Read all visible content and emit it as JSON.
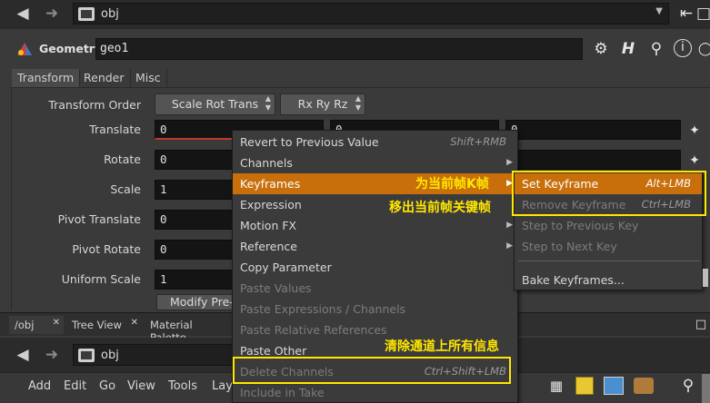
{
  "top_nav": {
    "path": "obj"
  },
  "geometry_header": {
    "type_label": "Geometry",
    "node_name": "geo1"
  },
  "param_tabs": [
    "Transform",
    "Render",
    "Misc"
  ],
  "params": {
    "transform_order": {
      "label": "Transform Order",
      "value": "Scale Rot Trans",
      "rot_value": "Rx Ry Rz"
    },
    "translate": {
      "label": "Translate",
      "values": [
        "0",
        "0",
        "0"
      ]
    },
    "rotate": {
      "label": "Rotate",
      "value": "0"
    },
    "scale": {
      "label": "Scale",
      "value": "1"
    },
    "pivot_translate": {
      "label": "Pivot Translate",
      "value": "0"
    },
    "pivot_rotate": {
      "label": "Pivot Rotate",
      "value": "0"
    },
    "uniform_scale": {
      "label": "Uniform Scale",
      "value": "1"
    },
    "modify_button": "Modify Pre-T"
  },
  "context_menu": {
    "items": [
      {
        "label": "Revert to Previous Value",
        "shortcut": "Shift+RMB"
      },
      {
        "label": "Channels"
      },
      {
        "label": "Keyframes"
      },
      {
        "label": "Expression"
      },
      {
        "label": "Motion FX"
      },
      {
        "label": "Reference"
      },
      {
        "label": "Copy Parameter"
      },
      {
        "label": "Paste Values"
      },
      {
        "label": "Paste Expressions / Channels"
      },
      {
        "label": "Paste Relative References"
      },
      {
        "label": "Paste Other"
      },
      {
        "label": "Delete Channels",
        "shortcut": "Ctrl+Shift+LMB"
      },
      {
        "label": "Include in Take"
      }
    ]
  },
  "submenu": {
    "items": [
      {
        "label": "Set Keyframe",
        "shortcut": "Alt+LMB"
      },
      {
        "label": "Remove Keyframe",
        "shortcut": "Ctrl+LMB"
      },
      {
        "label": "Step to Previous Key"
      },
      {
        "label": "Step to Next Key"
      },
      {
        "label": "Bake Keyframes..."
      }
    ]
  },
  "annotations": {
    "set_key": "为当前帧K帧",
    "remove_key": "移出当前帧关键帧",
    "delete_channels": "清除通道上所有信息"
  },
  "pane_tabs": [
    "/obj",
    "Tree View",
    "Material Palette"
  ],
  "bottom_nav": {
    "path": "obj"
  },
  "bottom_menu": [
    "Add",
    "Edit",
    "Go",
    "View",
    "Tools",
    "Lay"
  ],
  "colors": {
    "highlight": "#c86f0b",
    "annotation": "#ffe700"
  },
  "icons": [
    "back-arrow-icon",
    "forward-arrow-icon",
    "pin-icon",
    "dock-icon",
    "gear-icon",
    "help-icon",
    "search-icon",
    "info-icon",
    "settings-icon"
  ]
}
